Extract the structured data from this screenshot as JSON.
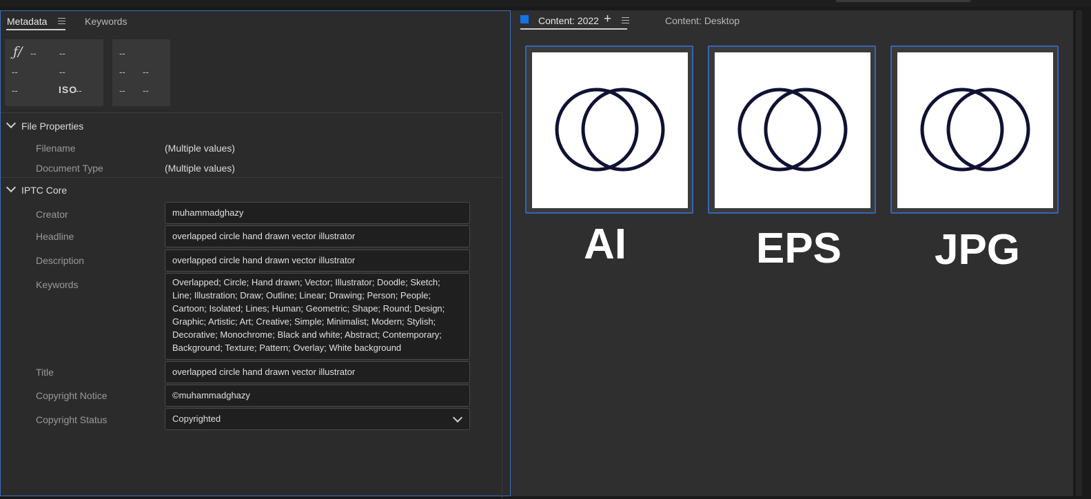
{
  "left_tabs": {
    "metadata": "Metadata",
    "keywords": "Keywords"
  },
  "exif": {
    "fstop_symbol": "ƒ/",
    "dash": "--",
    "iso": "ISO"
  },
  "file_properties": {
    "title": "File Properties",
    "rows": [
      {
        "label": "Filename",
        "value": "(Multiple values)"
      },
      {
        "label": "Document Type",
        "value": "(Multiple values)"
      }
    ]
  },
  "iptc": {
    "title": "IPTC Core",
    "creator": {
      "label": "Creator",
      "value": "muhammadghazy"
    },
    "headline": {
      "label": "Headline",
      "value": "overlapped circle hand drawn vector illustrator"
    },
    "description": {
      "label": "Description",
      "value": "overlapped circle hand drawn vector illustrator"
    },
    "keywords": {
      "label": "Keywords",
      "value": "Overlapped; Circle; Hand drawn; Vector; Illustrator; Doodle; Sketch;\nLine; Illustration; Draw; Outline; Linear; Drawing; Person; People;\nCartoon; Isolated; Lines; Human; Geometric; Shape; Round; Design;\nGraphic; Artistic; Art; Creative; Simple; Minimalist; Modern; Stylish;\nDecorative; Monochrome; Black and white; Abstract; Contemporary;\nBackground; Texture; Pattern; Overlay; White background"
    },
    "title_field": {
      "label": "Title",
      "value": "overlapped circle hand drawn vector illustrator"
    },
    "copyright_notice": {
      "label": "Copyright Notice",
      "value": "©muhammadghazy"
    },
    "copyright_status": {
      "label": "Copyright Status",
      "value": "Copyrighted"
    }
  },
  "right_tabs": {
    "content_2022": "Content: 2022",
    "plus": "+",
    "content_desktop": "Content: Desktop"
  },
  "thumbnails": [
    {
      "label": "AI"
    },
    {
      "label": "EPS"
    },
    {
      "label": "JPG"
    }
  ],
  "colors": {
    "accent": "#1473e6",
    "selection_border": "#3566b8",
    "circle_stroke": "#101233"
  }
}
